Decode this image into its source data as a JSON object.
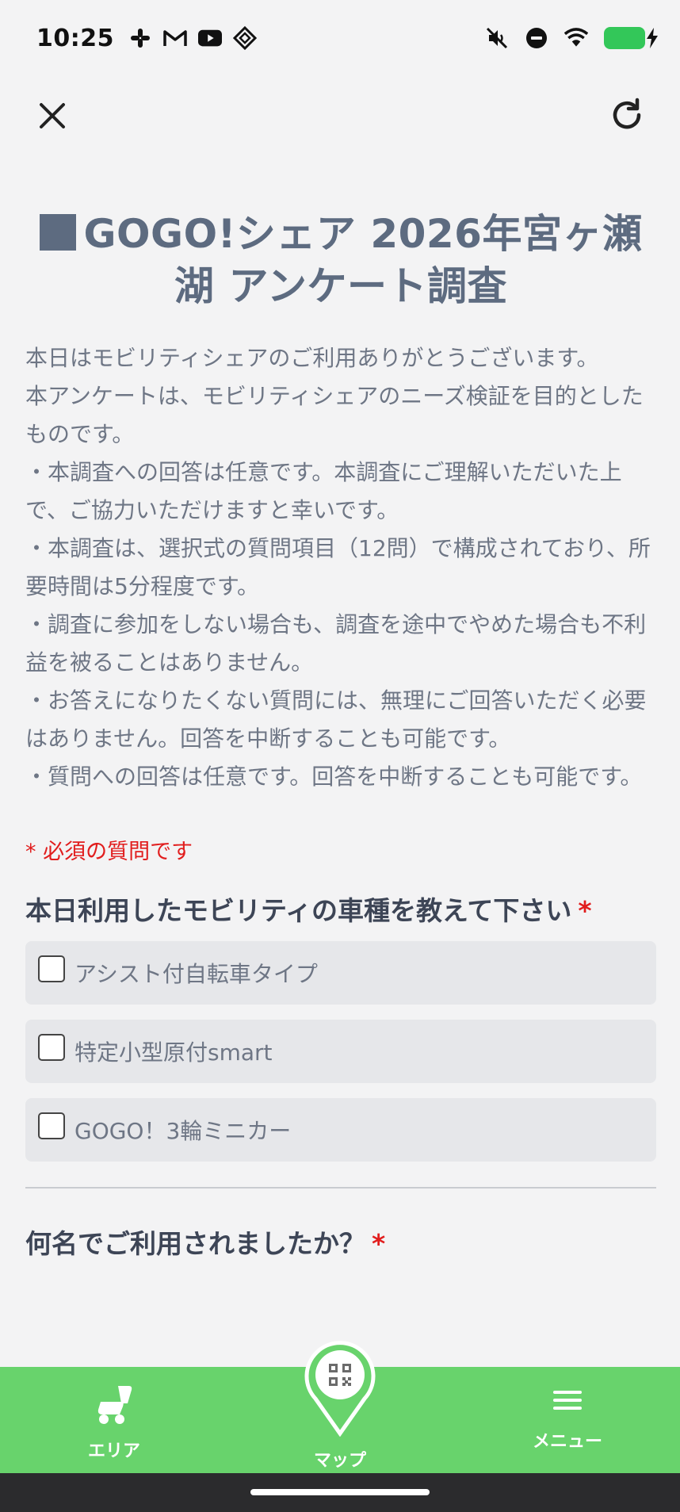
{
  "status_bar": {
    "time": "10:25",
    "left_icons": [
      "slack-icon",
      "gmail-icon",
      "youtube-icon",
      "diamond-app-icon"
    ],
    "right_icons": [
      "mute-icon",
      "dnd-icon",
      "wifi-icon",
      "battery-icon"
    ],
    "battery_level": 1.0,
    "battery_color": "#33c759"
  },
  "top_nav": {
    "close_icon": "close-icon",
    "reload_icon": "reload-icon"
  },
  "survey": {
    "title_line1": "GOGO!シェア 2026年宮ヶ瀬",
    "title_line2": "湖 アンケート調査",
    "intro": "本日はモビリティシェアのご利用ありがとうございます。\n本アンケートは、モビリティシェアのニーズ検証を目的としたものです。\n・本調査への回答は任意です。本調査にご理解いただいた上で、ご協力いただけますと幸いです。\n・本調査は、選択式の質問項目（12問）で構成されており、所要時間は5分程度です。\n・調査に参加をしない場合も、調査を途中でやめた場合も不利益を被ることはありません。\n・お答えになりたくない質問には、無理にご回答いただく必要はありません。回答を中断することも可能です。\n・質問への回答は任意です。回答を中断することも可能です。",
    "required_note": "* 必須の質問です",
    "question1": {
      "text": "本日利用したモビリティの車種を教えて下さい",
      "required_mark": "*",
      "options": [
        "アシスト付自転車タイプ",
        "特定小型原付smart",
        "GOGO！3輪ミニカー"
      ]
    },
    "question2": {
      "text": "何名でご利用されましたか？",
      "required_mark": "*"
    }
  },
  "bottom_nav": {
    "area_label": "エリア",
    "map_label": "マップ",
    "menu_label": "メニュー",
    "bg_color": "#68d36c"
  }
}
